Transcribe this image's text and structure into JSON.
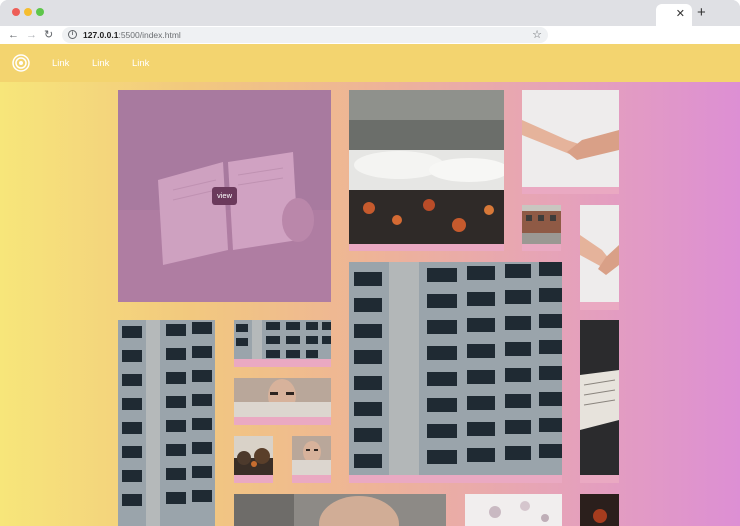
{
  "browser": {
    "tab_close": "✕",
    "new_tab": "+",
    "back_icon": "←",
    "forward_icon": "→",
    "reload_icon": "↻",
    "url_host": "127.0.0.1",
    "url_rest": ":5500/index.html",
    "star_icon": "☆"
  },
  "navbar": {
    "links": [
      "Link",
      "Link",
      "Link"
    ]
  },
  "gallery": {
    "view_label": "view"
  },
  "colors": {
    "navbar": "#f3d46f",
    "gradient_start": "#f7e67a",
    "gradient_end": "#dd8fd4",
    "overlay": "#c68eba",
    "view_button": "#6b3a5c"
  }
}
